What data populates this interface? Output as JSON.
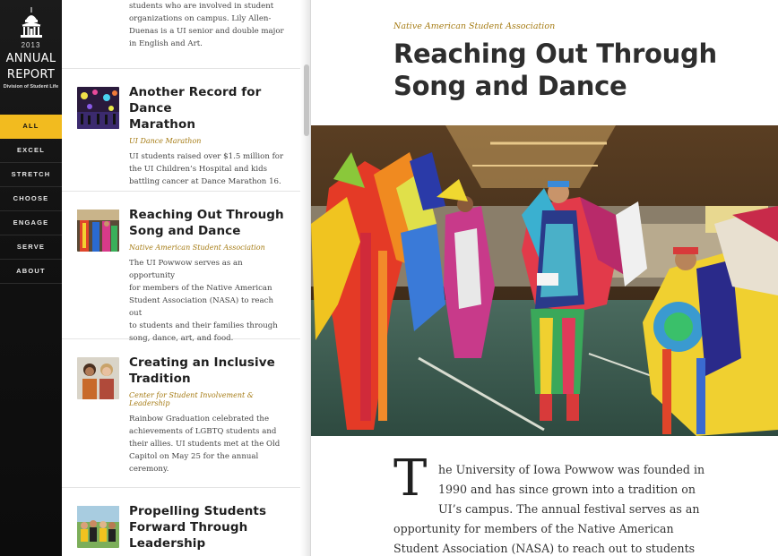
{
  "nav": {
    "year": "2013",
    "title_line1": "ANNUAL",
    "title_line2": "REPORT",
    "subtitle": "Division of Student Life",
    "items": [
      {
        "label": "ALL"
      },
      {
        "label": "EXCEL"
      },
      {
        "label": "STRETCH"
      },
      {
        "label": "CHOOSE"
      },
      {
        "label": "ENGAGE"
      },
      {
        "label": "SERVE"
      },
      {
        "label": "ABOUT"
      }
    ],
    "active": "ALL",
    "accent_color": "#f2bb1f"
  },
  "list": {
    "partial_item": {
      "desc_lines": [
        "students who are involved in student",
        "organizations on campus. Lily Allen-",
        "Duenas is a UI senior and double major",
        "in English and Art."
      ]
    },
    "items": [
      {
        "title_lines": [
          "Another Record for Dance",
          "Marathon"
        ],
        "category": "UI Dance Marathon",
        "desc_lines": [
          "UI students raised over $1.5 million for",
          "the UI Children’s Hospital and kids",
          "battling cancer at Dance Marathon 16."
        ]
      },
      {
        "title_lines": [
          "Reaching Out Through",
          "Song and Dance"
        ],
        "category": "Native American Student Association",
        "desc_lines": [
          "The UI Powwow serves as an opportunity",
          "for members of the Native American",
          "Student Association (NASA) to reach out",
          "to students and their families through",
          "song, dance, art, and food."
        ]
      },
      {
        "title_lines": [
          "Creating an Inclusive",
          "Tradition"
        ],
        "category": "Center for Student Involvement & Leadership",
        "desc_lines": [
          "Rainbow Graduation celebrated the",
          "achievements of LGBTQ students and",
          "their allies. UI students met at the Old",
          "Capitol on May 25 for the annual",
          "ceremony."
        ]
      },
      {
        "title_lines": [
          "Propelling Students",
          "Forward Through",
          "Leadership"
        ],
        "category": "",
        "desc_lines": []
      }
    ],
    "category_color": "#a67c15"
  },
  "article": {
    "kicker": "Native American Student Association",
    "title_lines": [
      "Reaching Out Through",
      "Song and Dance"
    ],
    "dropcap": "T",
    "body_lines": [
      "he University of Iowa Powwow was founded in",
      "1990 and has since grown into a tradition on",
      "UI’s campus.  The annual festival serves as an",
      "opportunity for members of the Native American",
      "Student Association (NASA) to reach out to students"
    ]
  }
}
